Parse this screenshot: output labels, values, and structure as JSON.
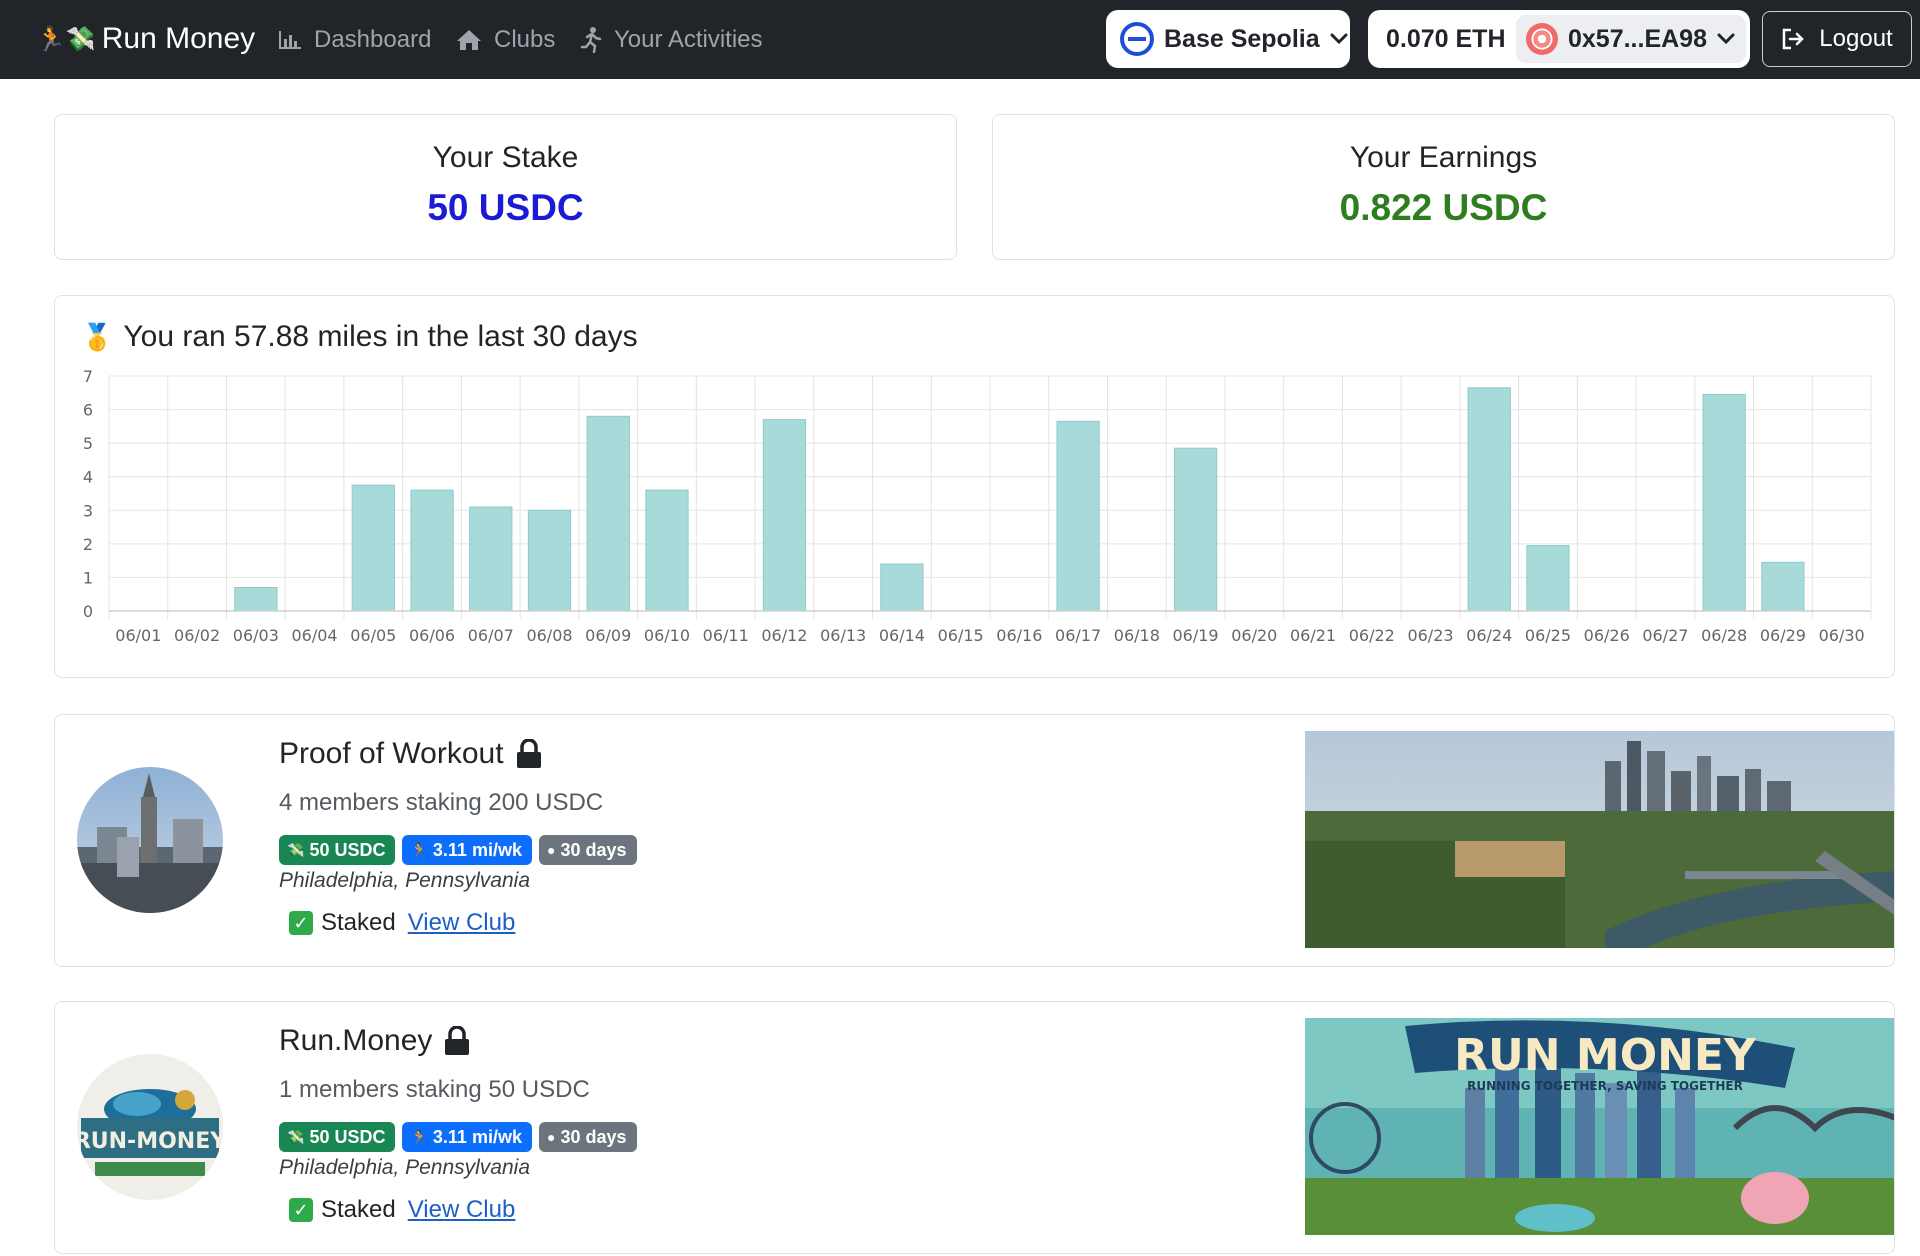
{
  "nav": {
    "brand_emoji": "🏃💸",
    "brand_label": "Run Money",
    "links": [
      {
        "label": "Dashboard",
        "icon": "bar-chart-icon"
      },
      {
        "label": "Clubs",
        "icon": "home-icon"
      },
      {
        "label": "Your Activities",
        "icon": "runner-icon"
      }
    ],
    "network_label": "Base Sepolia",
    "wallet_balance": "0.070 ETH",
    "wallet_address": "0x57...EA98",
    "logout_label": "Logout"
  },
  "stake": {
    "title": "Your Stake",
    "value": "50 USDC"
  },
  "earnings": {
    "title": "Your Earnings",
    "value": "0.822 USDC"
  },
  "activity": {
    "medal_emoji": "🥇",
    "title": "You ran 57.88 miles in the last 30 days"
  },
  "chart_data": {
    "type": "bar",
    "title": "",
    "xlabel": "",
    "ylabel": "",
    "ylim": [
      0,
      7
    ],
    "yticks": [
      0,
      1,
      2,
      3,
      4,
      5,
      6,
      7
    ],
    "grid": true,
    "bar_color": "#a8dada",
    "categories": [
      "06/01",
      "06/02",
      "06/03",
      "06/04",
      "06/05",
      "06/06",
      "06/07",
      "06/08",
      "06/09",
      "06/10",
      "06/11",
      "06/12",
      "06/13",
      "06/14",
      "06/15",
      "06/16",
      "06/17",
      "06/18",
      "06/19",
      "06/20",
      "06/21",
      "06/22",
      "06/23",
      "06/24",
      "06/25",
      "06/26",
      "06/27",
      "06/28",
      "06/29",
      "06/30"
    ],
    "values": [
      0,
      0,
      0.7,
      0,
      3.75,
      3.6,
      3.1,
      3.0,
      5.8,
      3.6,
      0,
      5.7,
      0,
      1.4,
      0,
      0,
      5.65,
      0,
      4.85,
      0,
      0,
      0,
      0,
      6.65,
      1.95,
      0,
      0,
      6.45,
      1.45,
      0
    ]
  },
  "clubs": [
    {
      "name": "Proof of Workout",
      "members": "4 members staking 200 USDC",
      "stake_badge": "50 USDC",
      "distance_badge": "3.11 mi/wk",
      "duration_badge": "30 days",
      "location": "Philadelphia, Pennsylvania",
      "status": "Staked",
      "view_label": "View Club"
    },
    {
      "name": "Run.Money",
      "members": "1 members staking 50 USDC",
      "stake_badge": "50 USDC",
      "distance_badge": "3.11 mi/wk",
      "duration_badge": "30 days",
      "location": "Philadelphia, Pennsylvania",
      "status": "Staked",
      "view_label": "View Club",
      "banner_text": "RUN MONEY",
      "banner_subtext": "RUNNING TOGETHER, SAVING TOGETHER",
      "avatar_text": "RUN-MONEY"
    }
  ]
}
